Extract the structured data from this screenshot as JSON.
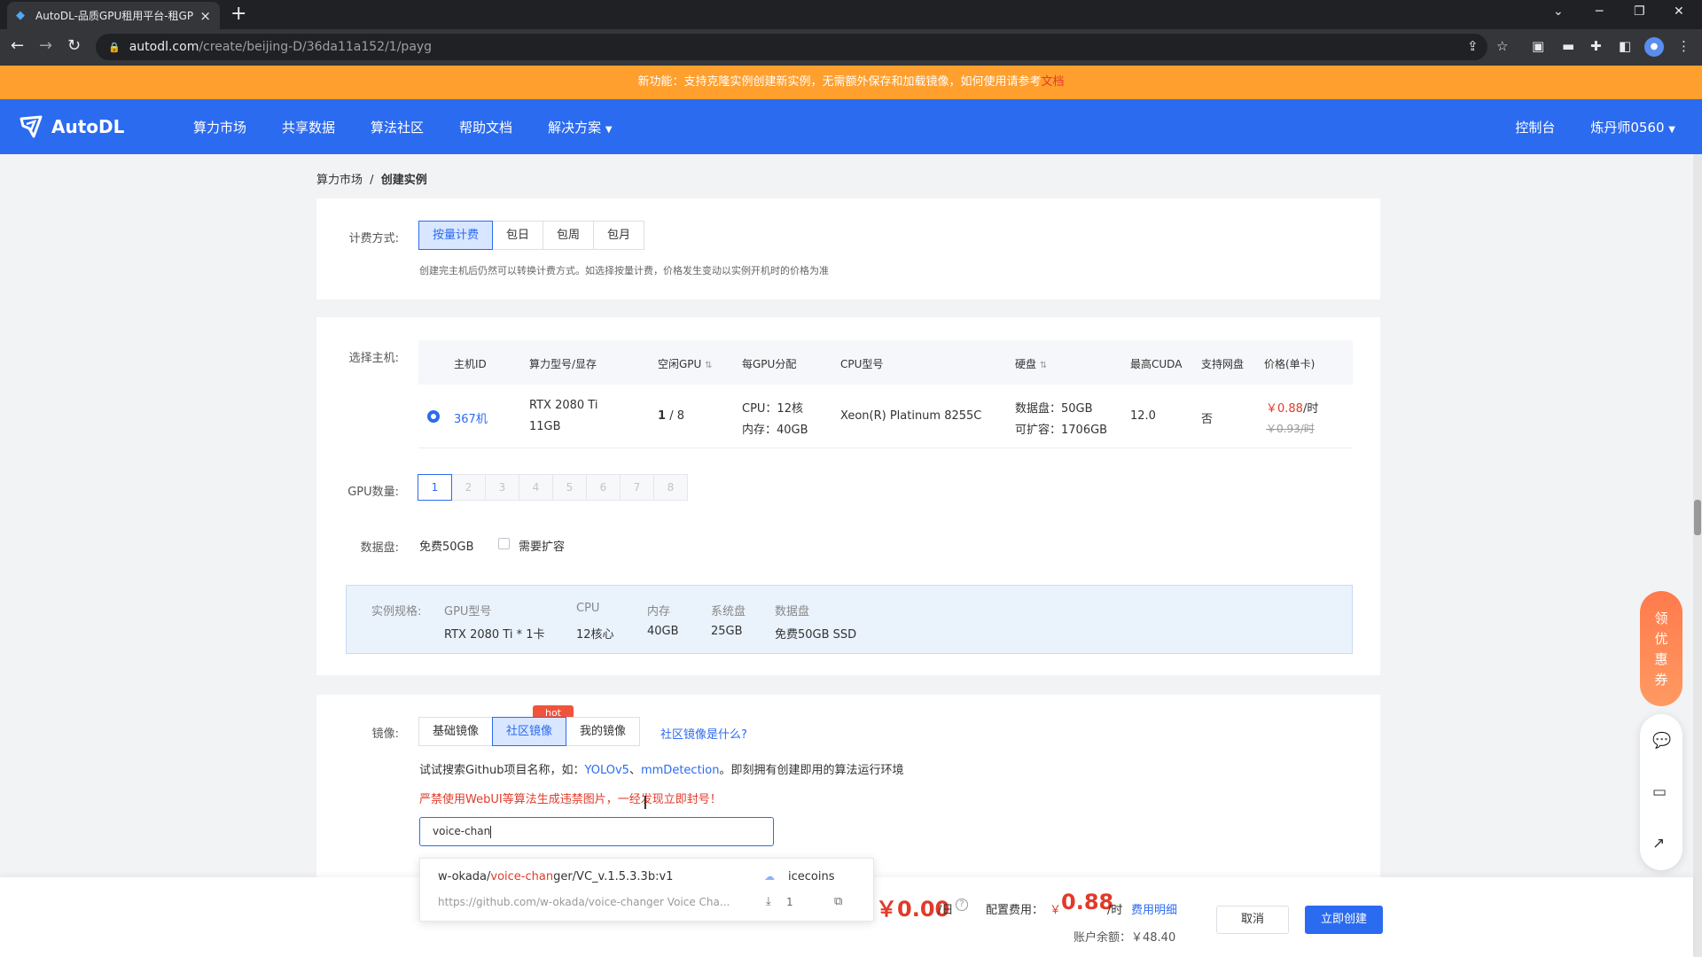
{
  "browser": {
    "tab_title": "AutoDL-品质GPU租用平台-租GP",
    "url_host": "autodl.com",
    "url_path": "/create/beijing-D/36da11a152/1/payg",
    "close_glyph": "×",
    "new_tab_glyph": "+"
  },
  "notice": {
    "text": "新功能：支持克隆实例创建新实例，无需额外保存和加载镜像，如何使用请参考",
    "link": "文档"
  },
  "header": {
    "brand": "AutoDL",
    "nav": [
      "算力市场",
      "共享数据",
      "算法社区",
      "帮助文档",
      "解决方案"
    ],
    "console": "控制台",
    "user": "炼丹师0560"
  },
  "breadcrumb": {
    "root": "算力市场",
    "sep": "/",
    "current": "创建实例"
  },
  "billing": {
    "label": "计费方式:",
    "options": [
      "按量计费",
      "包日",
      "包周",
      "包月"
    ],
    "selected": 0,
    "hint": "创建完主机后仍然可以转换计费方式。如选择按量计费，价格发生变动以实例开机时的价格为准"
  },
  "host": {
    "label": "选择主机:",
    "columns": [
      "主机ID",
      "算力型号/显存",
      "空闲GPU",
      "每GPU分配",
      "CPU型号",
      "硬盘",
      "最高CUDA",
      "支持网盘",
      "价格(单卡)"
    ],
    "row": {
      "id": "367机",
      "gpu_model": "RTX 2080 Ti",
      "vram": "11GB",
      "free_gpu": "1",
      "total_gpu": "/ 8",
      "cpu_alloc": "CPU：12核",
      "mem_alloc": "内存：40GB",
      "cpu_model": "Xeon(R) Platinum 8255C",
      "data_disk": "数据盘：50GB",
      "expandable": "可扩容：1706GB",
      "cuda": "12.0",
      "netdisk": "否",
      "price": "￥0.88",
      "price_unit": "/时",
      "original_price": "￥0.93/时"
    }
  },
  "gpu_count": {
    "label": "GPU数量:",
    "options": [
      "1",
      "2",
      "3",
      "4",
      "5",
      "6",
      "7",
      "8"
    ],
    "selected": 0
  },
  "disk": {
    "label": "数据盘:",
    "free": "免费50GB",
    "expand_label": "需要扩容"
  },
  "spec": {
    "label": "实例规格:",
    "headers": [
      "GPU型号",
      "CPU",
      "内存",
      "系统盘",
      "数据盘"
    ],
    "values": [
      "RTX 2080 Ti * 1卡",
      "12核心",
      "40GB",
      "25GB",
      "免费50GB SSD"
    ]
  },
  "image": {
    "label": "镜像:",
    "tabs": [
      "基础镜像",
      "社区镜像",
      "我的镜像"
    ],
    "selected": 1,
    "hot_badge": "hot",
    "help_link": "社区镜像是什么?",
    "hint_prefix": "试试搜索Github项目名称，如：",
    "hint_examples": [
      "YOLOv5",
      "mmDetection"
    ],
    "hint_sep": "、",
    "hint_suffix": "。即刻拥有创建即用的算法运行环境",
    "warning": "严禁使用WebUI等算法生成违禁图片，一经发现立即封号！",
    "search_value": "voice-chan"
  },
  "suggestion": {
    "prefix": "w-okada/",
    "match": "voice-chan",
    "rest": "ger/VC_v.1.5.3.3b:v1",
    "author": "icecoins",
    "desc": "https://github.com/w-okada/voice-changer Voice Cha...",
    "downloads": "1"
  },
  "footer": {
    "daily_price": "￥0.00",
    "daily_unit": "/日",
    "config_label": "配置费用：",
    "config_currency": "￥",
    "config_price": "0.88",
    "config_unit": "/时",
    "detail_link": "费用明细",
    "balance": "账户余额：￥48.40",
    "cancel": "取消",
    "create": "立即创建"
  },
  "side": {
    "coupon": "领优惠券"
  },
  "colors": {
    "primary": "#2b6bf0",
    "notice": "#ff9f2e",
    "price": "#e23a2a",
    "hot": "#f0533c"
  }
}
